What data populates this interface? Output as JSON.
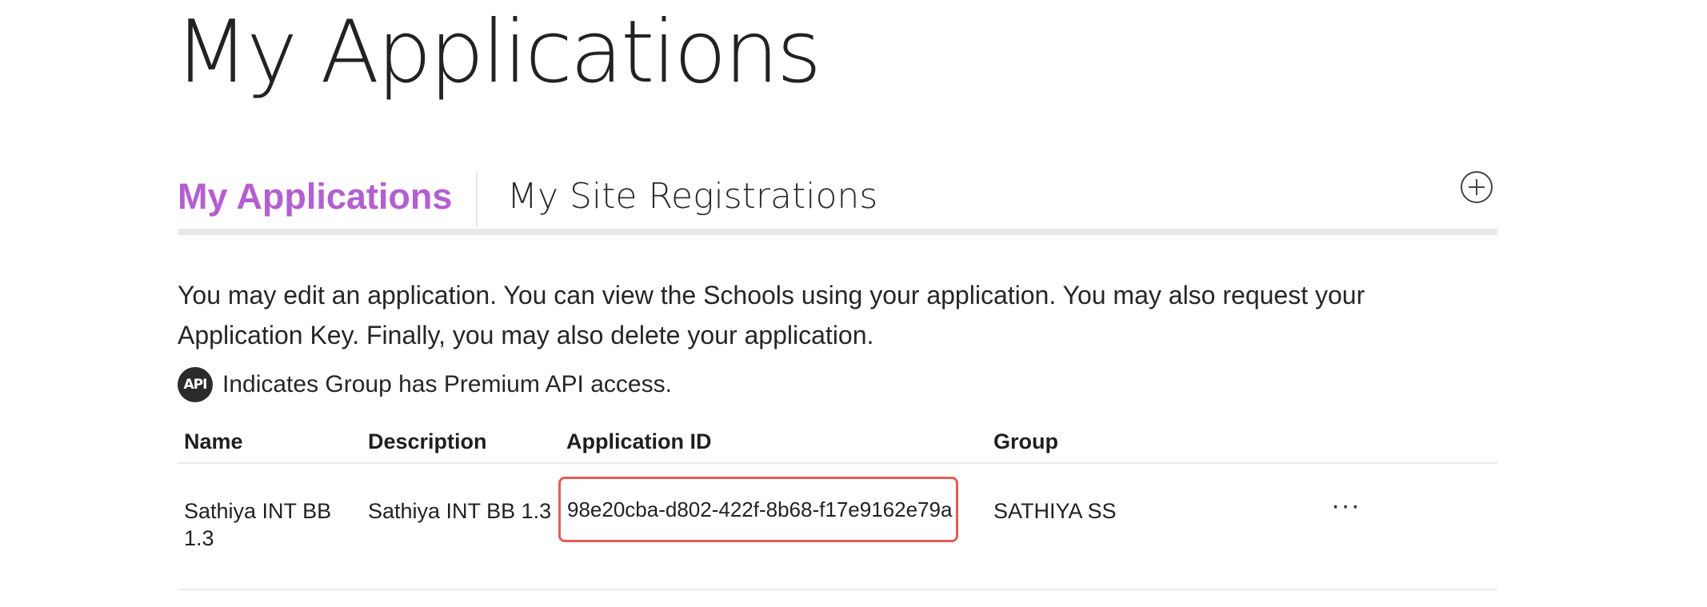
{
  "page": {
    "title": "My Applications"
  },
  "tabs": [
    {
      "label": "My Applications",
      "active": true
    },
    {
      "label": "My Site Registrations",
      "active": false
    }
  ],
  "add_button": {
    "icon": "plus-circle-icon"
  },
  "intro_text": "You may edit an application. You can view the Schools using your application. You may also request your Application Key. Finally, you may also delete your application.",
  "api_note": {
    "badge_text": "API",
    "text": "Indicates Group has Premium API access."
  },
  "table": {
    "headers": [
      "Name",
      "Description",
      "Application ID",
      "Group"
    ],
    "rows": [
      {
        "name": "Sathiya INT BB 1.3",
        "description": "Sathiya INT BB 1.3",
        "application_id": "98e20cba-d802-422f-8b68-f17e9162e79a",
        "group": "SATHIYA SS",
        "actions_label": "···"
      }
    ]
  },
  "colors": {
    "accent": "#b45fcf",
    "highlight_border": "#e55b5b",
    "divider": "#e8e8e8"
  }
}
